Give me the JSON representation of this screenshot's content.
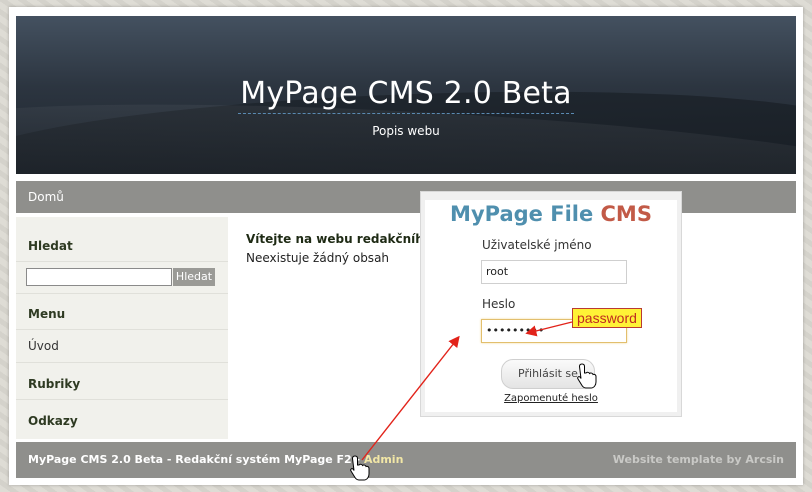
{
  "header": {
    "site_title": "MyPage CMS 2.0 Beta",
    "site_description": "Popis webu"
  },
  "nav": {
    "items": [
      {
        "label": "Domů"
      }
    ]
  },
  "sidebar": {
    "search_heading": "Hledat",
    "search_input_value": "",
    "search_button_label": "Hledat",
    "menu_heading": "Menu",
    "menu_items": [
      {
        "label": "Úvod"
      }
    ],
    "categories_heading": "Rubriky",
    "links_heading": "Odkazy"
  },
  "main": {
    "title": "Vítejte na webu redakčního systému MyPage",
    "empty_text": "Neexistuje žádný obsah"
  },
  "footer": {
    "left_text": "MyPage CMS 2.0 Beta - Redakční systém MyPage F2 - ",
    "admin_link": "Admin",
    "right_text": "Website template by Arcsin"
  },
  "login_dialog": {
    "logo_part1": "MyPage File",
    "logo_part2": "CMS",
    "username_label": "Uživatelské jméno",
    "username_value": "root",
    "password_label": "Heslo",
    "password_value": "•••••••••",
    "submit_label": "Přihlásit se",
    "forgot_link": "Zapomenuté heslo"
  },
  "annotation": {
    "callout_text": "password"
  },
  "icons": {
    "cursor_near_button": "hand-pointer-icon",
    "cursor_near_admin": "hand-pointer-icon"
  },
  "colors": {
    "header_dark": "#2c3540",
    "bar_gray": "#8f8f8c",
    "logo_blue": "#4f8fae",
    "logo_red": "#c25a47",
    "callout_yellow": "#fff236",
    "arrow_red": "#e2231a"
  }
}
